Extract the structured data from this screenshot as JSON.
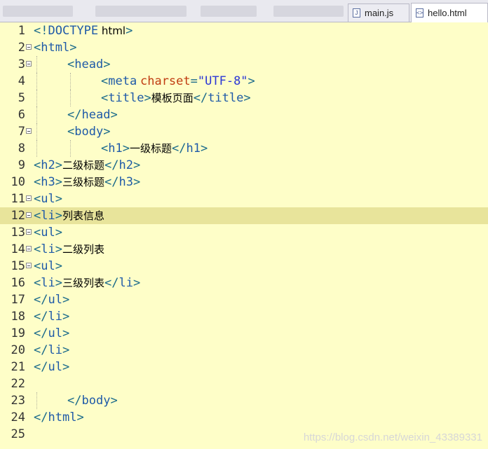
{
  "tabs": [
    {
      "label": "main.js",
      "icon": "js-file-icon",
      "active": false
    },
    {
      "label": "hello.html",
      "icon": "html-file-icon",
      "active": true
    }
  ],
  "current_line": 12,
  "lines": [
    {
      "n": "1",
      "fold": false,
      "indent": 0,
      "t": [
        [
          "pun",
          "<!"
        ],
        [
          "tag",
          "DOCTYPE"
        ],
        [
          "txt",
          " html"
        ],
        [
          "pun",
          ">"
        ]
      ]
    },
    {
      "n": "2",
      "fold": true,
      "indent": 0,
      "t": [
        [
          "pun",
          "<"
        ],
        [
          "tag",
          "html"
        ],
        [
          "pun",
          ">"
        ]
      ]
    },
    {
      "n": "3",
      "fold": true,
      "indent": 1,
      "t": [
        [
          "pun",
          "<"
        ],
        [
          "tag",
          "head"
        ],
        [
          "pun",
          ">"
        ]
      ]
    },
    {
      "n": "4",
      "fold": false,
      "indent": 2,
      "t": [
        [
          "pun",
          "<"
        ],
        [
          "tag",
          "meta"
        ],
        [
          "txt",
          " "
        ],
        [
          "attr",
          "charset"
        ],
        [
          "pun",
          "="
        ],
        [
          "str",
          "\"UTF-8\""
        ],
        [
          "pun",
          ">"
        ]
      ]
    },
    {
      "n": "5",
      "fold": false,
      "indent": 2,
      "t": [
        [
          "pun",
          "<"
        ],
        [
          "tag",
          "title"
        ],
        [
          "pun",
          ">"
        ],
        [
          "txt",
          "模板页面"
        ],
        [
          "pun",
          "</"
        ],
        [
          "tag",
          "title"
        ],
        [
          "pun",
          ">"
        ]
      ]
    },
    {
      "n": "6",
      "fold": false,
      "indent": 1,
      "t": [
        [
          "pun",
          "</"
        ],
        [
          "tag",
          "head"
        ],
        [
          "pun",
          ">"
        ]
      ]
    },
    {
      "n": "7",
      "fold": true,
      "indent": 1,
      "t": [
        [
          "pun",
          "<"
        ],
        [
          "tag",
          "body"
        ],
        [
          "pun",
          ">"
        ]
      ]
    },
    {
      "n": "8",
      "fold": false,
      "indent": 2,
      "t": [
        [
          "pun",
          "<"
        ],
        [
          "tag",
          "h1"
        ],
        [
          "pun",
          ">"
        ],
        [
          "txt",
          "一级标题"
        ],
        [
          "pun",
          "</"
        ],
        [
          "tag",
          "h1"
        ],
        [
          "pun",
          ">"
        ]
      ]
    },
    {
      "n": "9",
      "fold": false,
      "indent": 0,
      "t": [
        [
          "pun",
          "<"
        ],
        [
          "tag",
          "h2"
        ],
        [
          "pun",
          ">"
        ],
        [
          "txt",
          "二级标题"
        ],
        [
          "pun",
          "</"
        ],
        [
          "tag",
          "h2"
        ],
        [
          "pun",
          ">"
        ]
      ]
    },
    {
      "n": "10",
      "fold": false,
      "indent": 0,
      "t": [
        [
          "pun",
          "<"
        ],
        [
          "tag",
          "h3"
        ],
        [
          "pun",
          ">"
        ],
        [
          "txt",
          "三级标题"
        ],
        [
          "pun",
          "</"
        ],
        [
          "tag",
          "h3"
        ],
        [
          "pun",
          ">"
        ]
      ]
    },
    {
      "n": "11",
      "fold": true,
      "indent": 0,
      "t": [
        [
          "pun",
          "<"
        ],
        [
          "tag",
          "ul"
        ],
        [
          "pun",
          ">"
        ]
      ]
    },
    {
      "n": "12",
      "fold": true,
      "indent": 0,
      "t": [
        [
          "pun",
          "<"
        ],
        [
          "tag",
          "li"
        ],
        [
          "pun",
          ">"
        ],
        [
          "txt",
          "列表信息"
        ]
      ]
    },
    {
      "n": "13",
      "fold": true,
      "indent": 0,
      "t": [
        [
          "pun",
          "<"
        ],
        [
          "tag",
          "ul"
        ],
        [
          "pun",
          ">"
        ]
      ]
    },
    {
      "n": "14",
      "fold": true,
      "indent": 0,
      "t": [
        [
          "pun",
          "<"
        ],
        [
          "tag",
          "li"
        ],
        [
          "pun",
          ">"
        ],
        [
          "txt",
          "二级列表"
        ]
      ]
    },
    {
      "n": "15",
      "fold": true,
      "indent": 0,
      "t": [
        [
          "pun",
          "<"
        ],
        [
          "tag",
          "ul"
        ],
        [
          "pun",
          ">"
        ]
      ]
    },
    {
      "n": "16",
      "fold": false,
      "indent": 0,
      "t": [
        [
          "pun",
          "<"
        ],
        [
          "tag",
          "li"
        ],
        [
          "pun",
          ">"
        ],
        [
          "txt",
          "三级列表"
        ],
        [
          "pun",
          "</"
        ],
        [
          "tag",
          "li"
        ],
        [
          "pun",
          ">"
        ]
      ]
    },
    {
      "n": "17",
      "fold": false,
      "indent": 0,
      "t": [
        [
          "pun",
          "</"
        ],
        [
          "tag",
          "ul"
        ],
        [
          "pun",
          ">"
        ]
      ]
    },
    {
      "n": "18",
      "fold": false,
      "indent": 0,
      "t": [
        [
          "pun",
          "</"
        ],
        [
          "tag",
          "li"
        ],
        [
          "pun",
          ">"
        ]
      ]
    },
    {
      "n": "19",
      "fold": false,
      "indent": 0,
      "t": [
        [
          "pun",
          "</"
        ],
        [
          "tag",
          "ul"
        ],
        [
          "pun",
          ">"
        ]
      ]
    },
    {
      "n": "20",
      "fold": false,
      "indent": 0,
      "t": [
        [
          "pun",
          "</"
        ],
        [
          "tag",
          "li"
        ],
        [
          "pun",
          ">"
        ]
      ]
    },
    {
      "n": "21",
      "fold": false,
      "indent": 0,
      "t": [
        [
          "pun",
          "</"
        ],
        [
          "tag",
          "ul"
        ],
        [
          "pun",
          ">"
        ]
      ]
    },
    {
      "n": "22",
      "fold": false,
      "indent": 0,
      "t": []
    },
    {
      "n": "23",
      "fold": false,
      "indent": 1,
      "t": [
        [
          "pun",
          "</"
        ],
        [
          "tag",
          "body"
        ],
        [
          "pun",
          ">"
        ]
      ]
    },
    {
      "n": "24",
      "fold": false,
      "indent": 0,
      "t": [
        [
          "pun",
          "</"
        ],
        [
          "tag",
          "html"
        ],
        [
          "pun",
          ">"
        ]
      ]
    },
    {
      "n": "25",
      "fold": false,
      "indent": 0,
      "t": []
    }
  ],
  "watermark": "https://blog.csdn.net/weixin_43389331"
}
